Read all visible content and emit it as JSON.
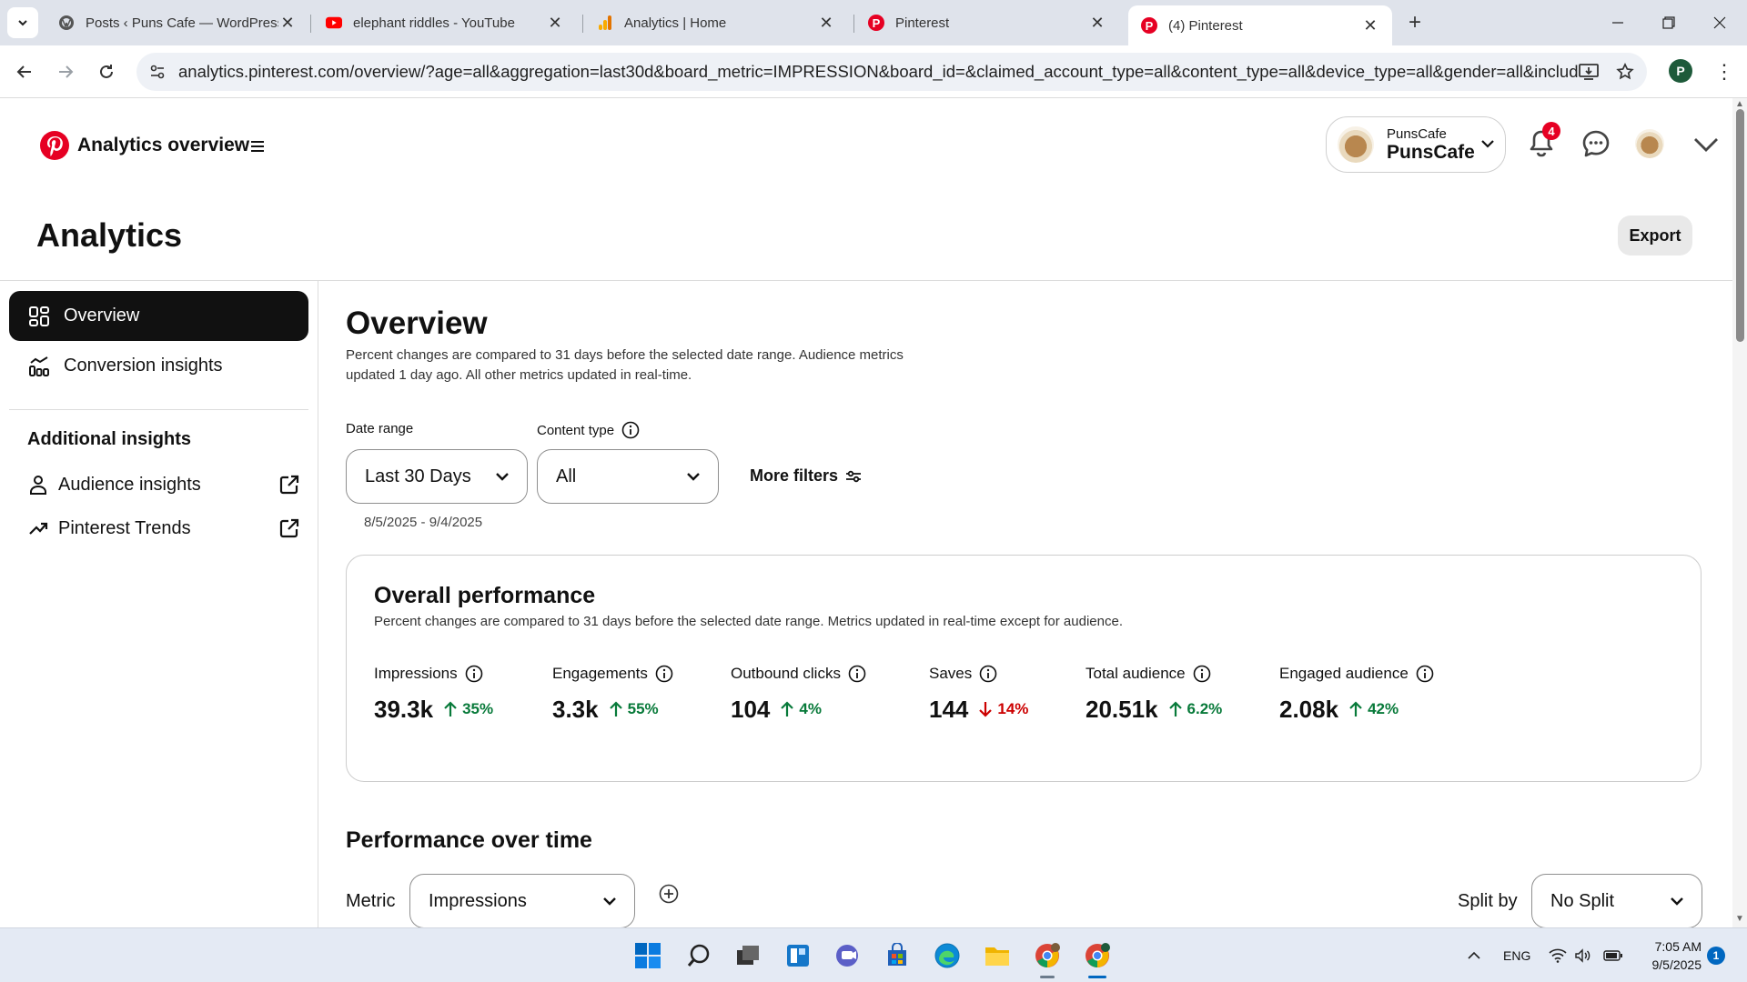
{
  "browser": {
    "tabs": [
      {
        "title": "Posts ‹ Puns Cafe — WordPress",
        "icon": "wordpress-icon"
      },
      {
        "title": "elephant riddles - YouTube",
        "icon": "youtube-icon"
      },
      {
        "title": "Analytics | Home",
        "icon": "google-analytics-icon"
      },
      {
        "title": "Pinterest",
        "icon": "pinterest-icon"
      },
      {
        "title": "(4) Pinterest",
        "icon": "pinterest-icon",
        "active": true
      }
    ],
    "url": "analytics.pinterest.com/overview/?age=all&aggregation=last30d&board_metric=IMPRESSION&board_id=&claimed_account_type=all&content_type=all&device_type=all&gender=all&include_cur...",
    "profile_initial": "P"
  },
  "header": {
    "app_title": "Analytics overview",
    "account_small": "PunsCafe",
    "account_big": "PunsCafe",
    "notification_count": "4"
  },
  "page": {
    "title": "Analytics",
    "export_label": "Export"
  },
  "sidebar": {
    "items": [
      {
        "label": "Overview",
        "active": true
      },
      {
        "label": "Conversion insights"
      }
    ],
    "additional_heading": "Additional insights",
    "links": [
      {
        "label": "Audience insights"
      },
      {
        "label": "Pinterest Trends"
      }
    ]
  },
  "overview": {
    "title": "Overview",
    "description": "Percent changes are compared to 31 days before the selected date range. Audience metrics updated 1 day ago. All other metrics updated in real-time.",
    "date_range_label": "Date range",
    "date_range_value": "Last 30 Days",
    "content_type_label": "Content type",
    "content_type_value": "All",
    "more_filters": "More filters",
    "date_span": "8/5/2025 - 9/4/2025"
  },
  "performance": {
    "title": "Overall performance",
    "description": "Percent changes are compared to 31 days before the selected date range. Metrics updated in real-time except for audience.",
    "metrics": [
      {
        "label": "Impressions",
        "value": "39.3k",
        "change": "35%",
        "direction": "up"
      },
      {
        "label": "Engagements",
        "value": "3.3k",
        "change": "55%",
        "direction": "up"
      },
      {
        "label": "Outbound clicks",
        "value": "104",
        "change": "4%",
        "direction": "up"
      },
      {
        "label": "Saves",
        "value": "144",
        "change": "14%",
        "direction": "down"
      },
      {
        "label": "Total audience",
        "value": "20.51k",
        "change": "6.2%",
        "direction": "up"
      },
      {
        "label": "Engaged audience",
        "value": "2.08k",
        "change": "42%",
        "direction": "up"
      }
    ]
  },
  "over_time": {
    "title": "Performance over time",
    "metric_label": "Metric",
    "metric_value": "Impressions",
    "split_label": "Split by",
    "split_value": "No Split"
  },
  "taskbar": {
    "language": "ENG",
    "time": "7:05 AM",
    "date": "9/5/2025",
    "notification_count": "1"
  },
  "colors": {
    "pinterest_red": "#e60023",
    "positive": "#087a3a",
    "negative": "#cc0000",
    "active_nav": "#111111"
  }
}
